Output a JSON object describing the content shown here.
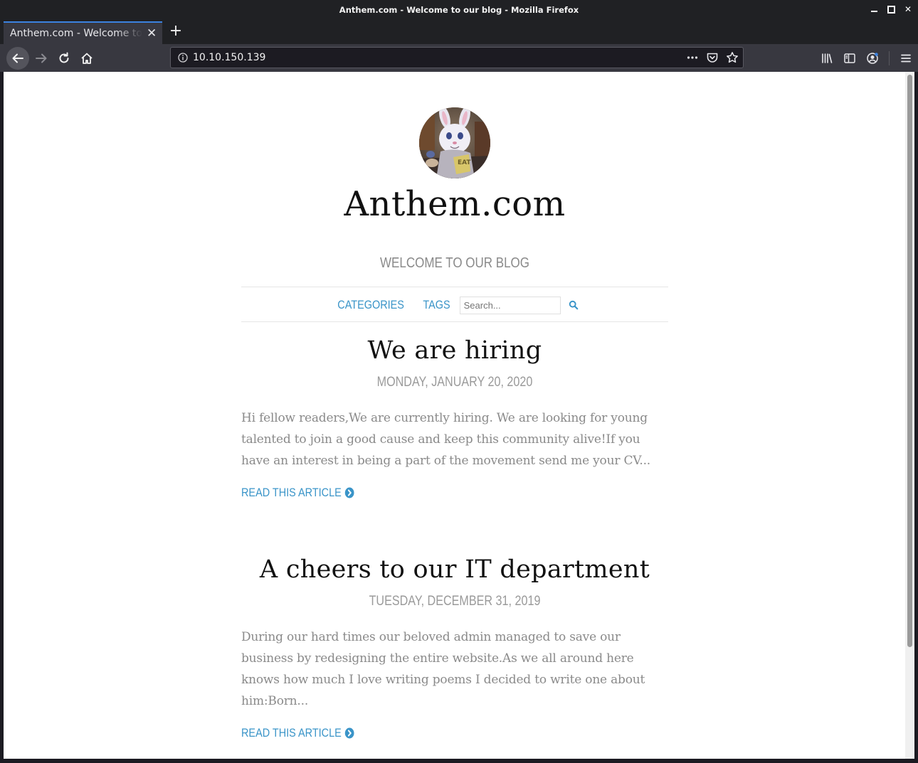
{
  "window": {
    "title": "Anthem.com - Welcome to our blog - Mozilla Firefox"
  },
  "tab": {
    "title": "Anthem.com - Welcome to our blog"
  },
  "urlbar": {
    "url": "10.10.150.139"
  },
  "icons": {
    "back": "arrow-left-icon",
    "forward": "arrow-right-icon",
    "reload": "reload-icon",
    "home": "home-icon",
    "page_actions": "ellipsis-icon",
    "pocket": "pocket-icon",
    "bookmark": "star-icon",
    "library": "library-icon",
    "sidebar": "sidebar-icon",
    "account": "account-icon",
    "menu": "hamburger-icon"
  },
  "colors": {
    "accent": "#3a94c8",
    "tab_highlight": "#3b82e0",
    "chrome_bg": "#202124",
    "toolbar_bg": "#383840"
  },
  "blog": {
    "site_title": "Anthem.com",
    "tagline": "WELCOME TO OUR BLOG",
    "nav": {
      "categories": "CATEGORIES",
      "tags": "TAGS",
      "search_placeholder": "Search..."
    },
    "posts": [
      {
        "title": "We are hiring",
        "date": "MONDAY, JANUARY 20, 2020",
        "excerpt": "Hi fellow readers,We are currently hiring. We are looking for young talented to join a good cause and keep this community alive!If you have an interest in being a part of the movement send me your CV...",
        "read_more": "READ THIS ARTICLE"
      },
      {
        "title": "A cheers to our IT department",
        "date": "TUESDAY, DECEMBER 31, 2019",
        "excerpt": "During our hard times our beloved admin managed to save our business by redesigning the entire website.As we all around here knows how much I love writing poems I decided to write one about him:Born...",
        "read_more": "READ THIS ARTICLE"
      }
    ]
  }
}
